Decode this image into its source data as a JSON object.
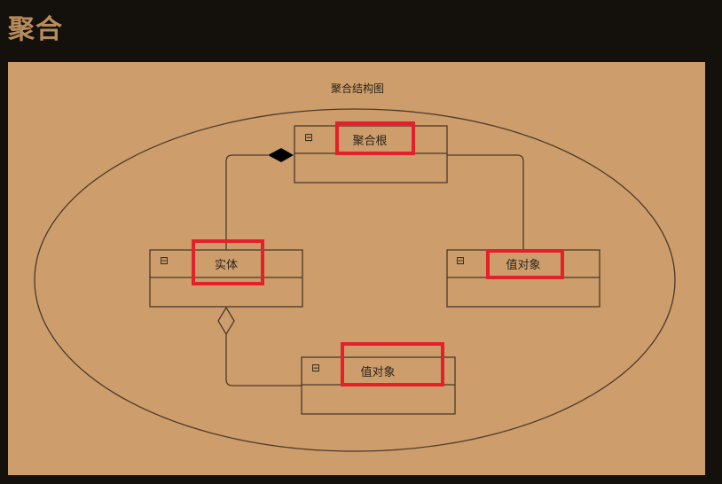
{
  "page": {
    "title": "聚合"
  },
  "diagram": {
    "title": "聚合结构图",
    "boxes": {
      "root": "聚合根",
      "entity": "实体",
      "value_right": "值对象",
      "value_bottom": "值对象"
    },
    "collapse_glyph": "⊟",
    "colors": {
      "background": "#14100c",
      "canvas": "#cd9d6b",
      "line": "#4a3a2c",
      "highlight": "#e4202a",
      "heading": "#b88d5e"
    }
  }
}
